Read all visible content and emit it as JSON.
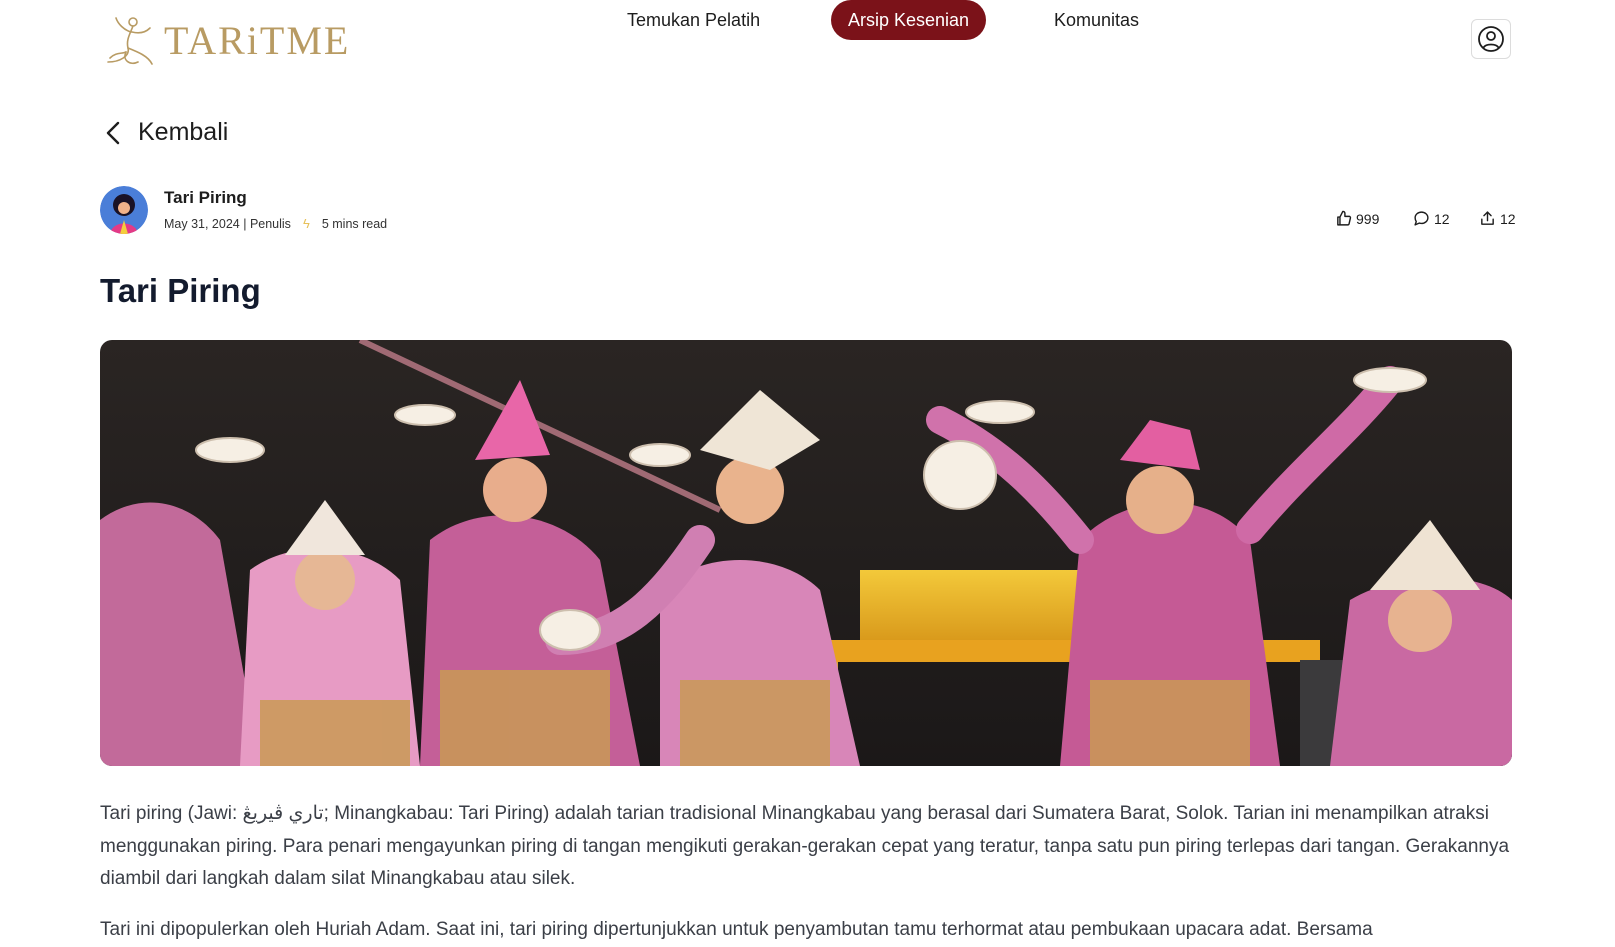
{
  "brand": {
    "name": "TARiTME"
  },
  "nav": {
    "items": [
      {
        "label": "Temukan Pelatih",
        "active": false
      },
      {
        "label": "Arsip Kesenian",
        "active": true
      },
      {
        "label": "Komunitas",
        "active": false
      }
    ]
  },
  "back": {
    "label": "Kembali"
  },
  "author": {
    "name": "Tari Piring",
    "date_role": "May 31, 2024 | Penulis",
    "read_time": "5 mins read"
  },
  "stats": {
    "likes": "999",
    "comments": "12",
    "shares": "12"
  },
  "article": {
    "title": "Tari Piring",
    "paragraphs": [
      "Tari piring (Jawi: تاري ڤيريڠ; Minangkabau: Tari Piring) adalah tarian tradisional Minangkabau yang berasal dari Sumatera Barat, Solok. Tarian ini menampilkan atraksi menggunakan piring. Para penari mengayunkan piring di tangan mengikuti gerakan-gerakan cepat yang teratur, tanpa satu pun piring terlepas dari tangan. Gerakannya diambil dari langkah dalam silat Minangkabau atau silek.",
      "Tari ini dipopulerkan oleh Huriah Adam. Saat ini, tari piring dipertunjukkan untuk penyambutan tamu terhormat atau pembukaan upacara adat. Bersama"
    ]
  },
  "colors": {
    "accent": "#7b1219",
    "brand": "#b89b63",
    "title": "#131b2e",
    "body_text": "#3b3f47"
  },
  "icons": {
    "back": "chevron-left-icon",
    "profile": "user-circle-icon",
    "like": "thumbs-up-icon",
    "comment": "chat-bubble-icon",
    "share": "share-upload-icon",
    "read_time": "lightning-icon"
  }
}
